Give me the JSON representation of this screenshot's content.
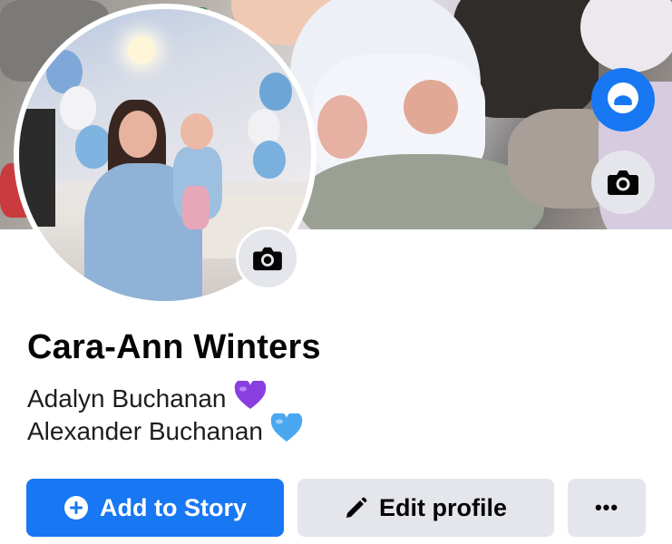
{
  "profile": {
    "name": "Cara-Ann Winters",
    "bio_lines": [
      {
        "text": "Adalyn Buchanan",
        "emoji": "purple-heart",
        "emoji_color": "#8a3ee0"
      },
      {
        "text": "Alexander Buchanan",
        "emoji": "blue-heart",
        "emoji_color": "#4aa8f0"
      }
    ]
  },
  "photos": {
    "cover_icon": "camera-icon",
    "avatar_icon": "camera-icon",
    "bubble_icon": "avatar-bubble-icon"
  },
  "actions": {
    "add_story_label": "Add to Story",
    "add_story_icon": "plus-circle-icon",
    "edit_profile_label": "Edit profile",
    "edit_profile_icon": "pencil-icon",
    "more_label": "•••"
  },
  "colors": {
    "accent": "#1877f2",
    "secondary_button": "#e4e6eb",
    "text_primary": "#050505"
  }
}
